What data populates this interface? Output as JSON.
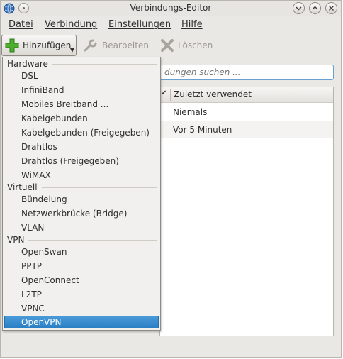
{
  "window": {
    "title": "Verbindungs-Editor"
  },
  "menubar": {
    "items": [
      {
        "label": "Datei"
      },
      {
        "label": "Verbindung"
      },
      {
        "label": "Einstellungen"
      },
      {
        "label": "Hilfe"
      }
    ]
  },
  "toolbar": {
    "add_label": "Hinzufügen",
    "edit_label": "Bearbeiten",
    "delete_label": "Löschen"
  },
  "search": {
    "placeholder": "dungen suchen ..."
  },
  "table": {
    "header_last_used": "Zuletzt verwendet",
    "rows": [
      {
        "last_used": "Niemals"
      },
      {
        "last_used": "Vor 5 Minuten"
      }
    ]
  },
  "add_menu": {
    "sections": [
      {
        "title": "Hardware",
        "items": [
          "DSL",
          "InfiniBand",
          "Mobiles Breitband ...",
          "Kabelgebunden",
          "Kabelgebunden (Freigegeben)",
          "Drahtlos",
          "Drahtlos (Freigegeben)",
          "WiMAX"
        ]
      },
      {
        "title": "Virtuell",
        "items": [
          "Bündelung",
          "Netzwerkbrücke (Bridge)",
          "VLAN"
        ]
      },
      {
        "title": "VPN",
        "items": [
          "OpenSwan",
          "PPTP",
          "OpenConnect",
          "L2TP",
          "VPNC",
          "OpenVPN"
        ]
      }
    ],
    "selected": "OpenVPN"
  },
  "colors": {
    "selection": "#2a7fc4",
    "window_bg": "#e9e8e5",
    "search_border": "#6aa0cf"
  },
  "icons": {
    "app": "network-icon",
    "add": "plus-icon",
    "edit": "wrench-icon",
    "delete": "delete-icon"
  }
}
